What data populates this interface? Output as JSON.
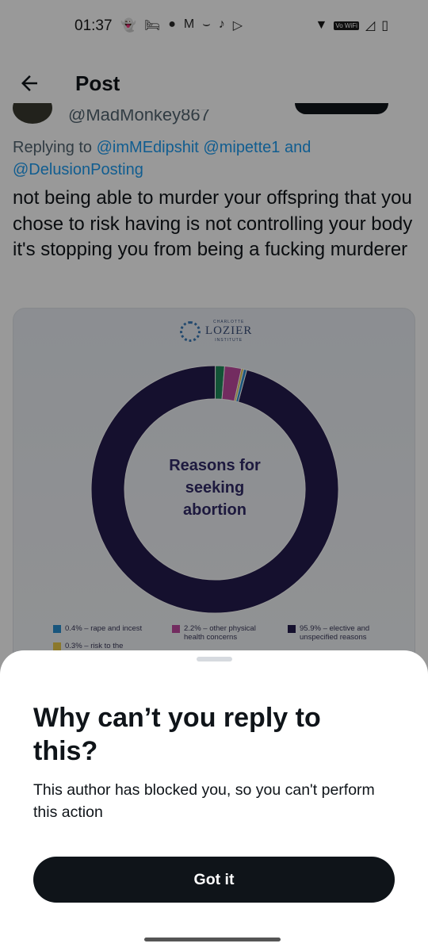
{
  "status_bar": {
    "time": "01:37",
    "left_icons": [
      "snapchat-icon",
      "bed-icon",
      "reddit-icon",
      "gmail-icon",
      "amazon-icon",
      "tiktok-icon",
      "play-store-icon"
    ],
    "right_icons": [
      "wifi-icon",
      "vowifi-icon",
      "signal-icon",
      "battery-icon"
    ],
    "vowifi_label": "Vo WiFi"
  },
  "header": {
    "title": "Post"
  },
  "tweet": {
    "handle": "@MadMonkey867",
    "replying_prefix": "Replying to",
    "mentions": [
      "@imMEdipshit",
      "@mipette1"
    ],
    "replying_and": "and",
    "mention_last": "@DelusionPosting",
    "text": "not being able to murder your offspring that you chose to risk having is not controlling your body it's stopping you from being a fucking murderer"
  },
  "media": {
    "brand_top": "CHARLOTTE",
    "brand_name": "LOZIER",
    "brand_sub": "INSTITUTE"
  },
  "chart_data": {
    "type": "pie",
    "title": "Reasons for seeking abortion",
    "categories": [
      "0.4% – rape and incest",
      "2.2% – other physical health concerns",
      "95.9% – elective and unspecified reasons",
      "0.3% – risk to the"
    ],
    "values": [
      0.4,
      2.2,
      95.9,
      0.3
    ],
    "extra_slices_unlabeled": [
      {
        "value": 1.2,
        "color": "#1f8a5a"
      }
    ],
    "colors": [
      "#2a8fd0",
      "#c04aa0",
      "#231b4d",
      "#e8c94a"
    ],
    "legend_position": "bottom"
  },
  "sheet": {
    "title": "Why can’t you reply to this?",
    "body": "This author has blocked you, so you can't perform this action",
    "button_label": "Got it"
  },
  "colors": {
    "link": "#1d9bf0",
    "text": "#0f1419",
    "muted": "#536471",
    "button": "#0f1419"
  }
}
